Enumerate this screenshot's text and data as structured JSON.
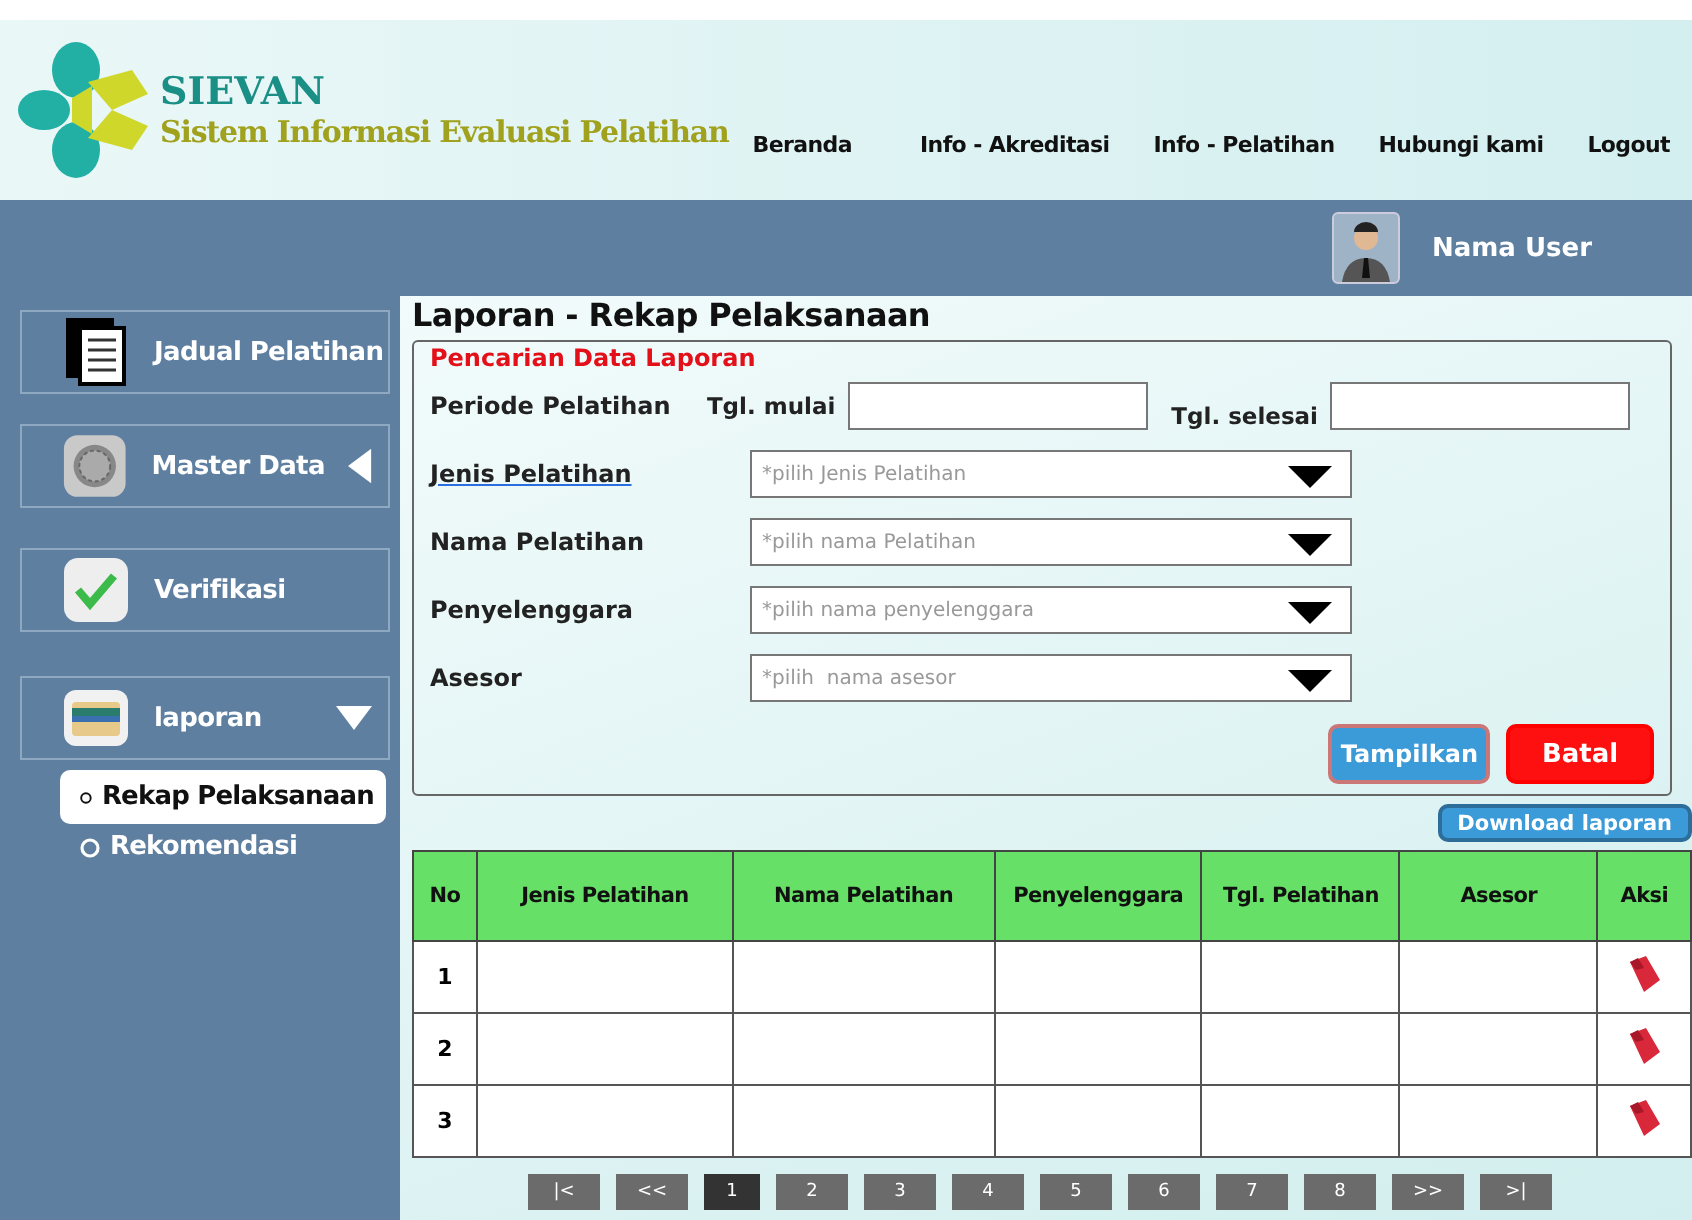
{
  "header": {
    "brand": "SIEVAN",
    "subtitle": "Sistem Informasi Evaluasi Pelatihan",
    "nav": [
      "Beranda",
      "Info - Akreditasi",
      "Info - Pelatihan",
      "Hubungi kami",
      "Logout"
    ]
  },
  "user": {
    "name": "Nama User"
  },
  "sidebar": {
    "items": [
      {
        "label": "Jadual Pelatihan"
      },
      {
        "label": "Master Data",
        "expanded": false
      },
      {
        "label": "Verifikasi"
      },
      {
        "label": "laporan",
        "expanded": true,
        "children": [
          {
            "label": "Rekap Pelaksanaan",
            "selected": true
          },
          {
            "label": "Rekomendasi",
            "selected": false
          }
        ]
      }
    ]
  },
  "page_title": "Laporan - Rekap Pelaksanaan",
  "search": {
    "title": "Pencarian Data Laporan",
    "rows": [
      {
        "kind": "date_range",
        "label": "Periode Pelatihan",
        "underlined": false,
        "start_label": "Tgl. mulai",
        "end_label": "Tgl. selesai"
      },
      {
        "kind": "select",
        "label": "Jenis Pelatihan",
        "underlined": true,
        "placeholder": "*pilih Jenis Pelatihan"
      },
      {
        "kind": "select",
        "label": "Nama Pelatihan",
        "underlined": false,
        "placeholder": "*pilih nama Pelatihan"
      },
      {
        "kind": "select",
        "label": "Penyelenggara",
        "underlined": false,
        "placeholder": "*pilih nama penyelenggara"
      },
      {
        "kind": "select",
        "label": "Asesor",
        "underlined": false,
        "placeholder": "*pilih  nama asesor"
      }
    ],
    "buttons": [
      {
        "label": "Tampilkan",
        "kind": "primary"
      },
      {
        "label": "Batal",
        "kind": "danger"
      }
    ]
  },
  "download": "Download laporan",
  "table": {
    "columns": [
      "No",
      "Jenis Pelatihan",
      "Nama Pelatihan",
      "Penyelenggara",
      "Tgl. Pelatihan",
      "Asesor",
      "Aksi"
    ],
    "rows": [
      {
        "no": "1"
      },
      {
        "no": "2"
      },
      {
        "no": "3"
      }
    ]
  },
  "pagination": [
    {
      "label": "|<",
      "selected": false
    },
    {
      "label": "<<",
      "selected": false
    },
    {
      "label": "1",
      "selected": true
    },
    {
      "label": "2",
      "selected": false
    },
    {
      "label": "3",
      "selected": false
    },
    {
      "label": "4",
      "selected": false
    },
    {
      "label": "5",
      "selected": false
    },
    {
      "label": "6",
      "selected": false
    },
    {
      "label": "7",
      "selected": false
    },
    {
      "label": "8",
      "selected": false
    },
    {
      "label": ">>",
      "selected": false
    },
    {
      "label": ">|",
      "selected": false
    }
  ]
}
